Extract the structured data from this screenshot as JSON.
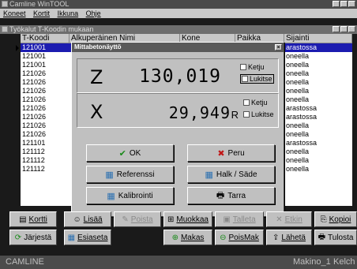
{
  "window": {
    "title": "Camline WinTOOL",
    "menu": [
      "Koneet",
      "Kortit",
      "Ikkuna",
      "Ohje"
    ]
  },
  "mdi": {
    "title": "Työkalut T-Koodin mukaan"
  },
  "table": {
    "headers": [
      "T-Koodi",
      "Alkuperäinen Nimi",
      "Kone",
      "Paikka",
      "Sijainti"
    ],
    "rows": [
      {
        "code": "121001",
        "loc": "arastossa"
      },
      {
        "code": "121001",
        "loc": "oneella"
      },
      {
        "code": "121001",
        "loc": "oneella"
      },
      {
        "code": "121026",
        "loc": "oneella"
      },
      {
        "code": "121026",
        "loc": "oneella"
      },
      {
        "code": "121026",
        "loc": "oneella"
      },
      {
        "code": "121026",
        "loc": "oneella"
      },
      {
        "code": "121026",
        "loc": "arastossa"
      },
      {
        "code": "121026",
        "loc": "arastossa"
      },
      {
        "code": "121026",
        "loc": "oneella"
      },
      {
        "code": "121026",
        "loc": "oneella"
      },
      {
        "code": "121101",
        "loc": "arastossa"
      },
      {
        "code": "121112",
        "loc": "oneella"
      },
      {
        "code": "121112",
        "loc": "oneella"
      },
      {
        "code": "121112",
        "loc": "oneella"
      }
    ]
  },
  "dialog": {
    "title": "Mittabetonäyttö",
    "z": {
      "letter": "Z",
      "value": "130,019",
      "ketju": "Ketju",
      "lukitse": "Lukitse"
    },
    "x": {
      "letter": "X",
      "value": "29,949",
      "suffix": "R",
      "ketju": "Ketju",
      "lukitse": "Lukitse"
    },
    "buttons": {
      "ok": "OK",
      "peru": "Peru",
      "ref": "Referenssi",
      "halk": "Halk / Säde",
      "kal": "Kalibrointi",
      "tarra": "Tarra"
    }
  },
  "toolbar1": [
    "Kortti",
    "Lisää",
    "Poista",
    "Muokkaa",
    "Talleta",
    "Etkin",
    "Kopioi"
  ],
  "toolbar2": [
    "Järjestä",
    "Esiaseta",
    "Makas",
    "PoisMak",
    "Lähetä",
    "Tulosta"
  ],
  "status": {
    "left": "CAMLINE",
    "mid": "Makino_1",
    "right": "Kelch"
  }
}
